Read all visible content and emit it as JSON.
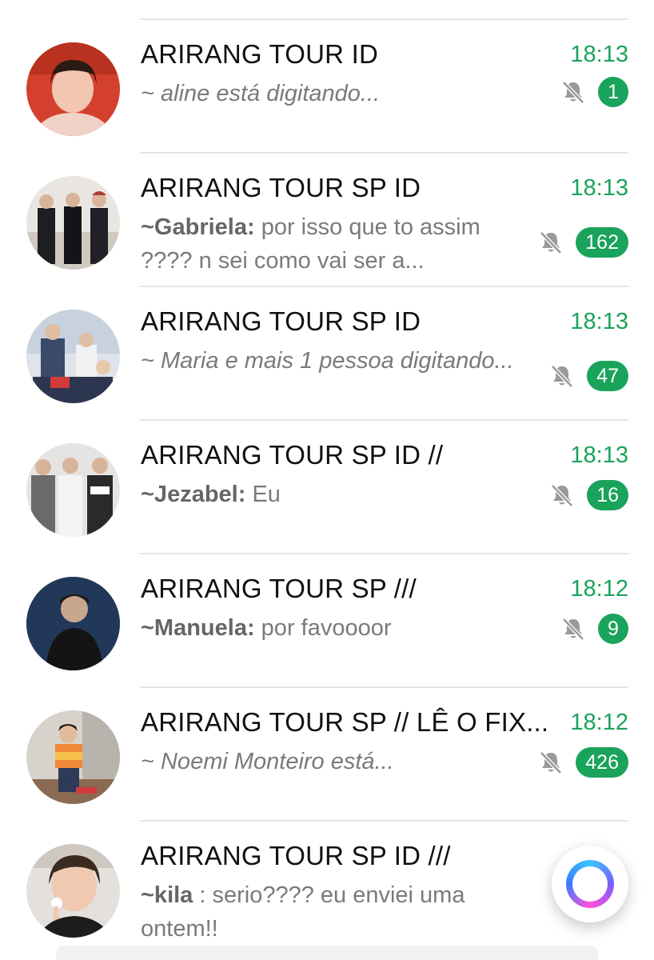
{
  "chats": [
    {
      "title": "ARIRANG TOUR ID",
      "time": "18:13",
      "sender": "",
      "message": "~ aline está digitando...",
      "italic": true,
      "muted": true,
      "unread": "1",
      "avatar_icon": "group-avatar-icon"
    },
    {
      "title": "ARIRANG TOUR SP ID",
      "time": "18:13",
      "sender": "~Gabriela:",
      "message": " por isso que to assim ???? n sei como vai ser a...",
      "italic": false,
      "muted": true,
      "unread": "162",
      "avatar_icon": "group-avatar-icon"
    },
    {
      "title": "ARIRANG TOUR SP ID",
      "time": "18:13",
      "sender": "",
      "message": "~ Maria e mais 1 pessoa digitando...",
      "italic": true,
      "muted": true,
      "unread": "47",
      "avatar_icon": "group-avatar-icon"
    },
    {
      "title": "ARIRANG TOUR SP ID //",
      "time": "18:13",
      "sender": "~Jezabel:",
      "message": " Eu",
      "italic": false,
      "muted": true,
      "unread": "16",
      "avatar_icon": "group-avatar-icon"
    },
    {
      "title": "ARIRANG TOUR SP ///",
      "time": "18:12",
      "sender": "~Manuela:",
      "message": " por favoooor",
      "italic": false,
      "muted": true,
      "unread": "9",
      "avatar_icon": "group-avatar-icon"
    },
    {
      "title": "ARIRANG TOUR SP // LÊ O FIX...",
      "time": "18:12",
      "sender": "",
      "message": "~ Noemi Monteiro está...",
      "italic": true,
      "muted": true,
      "unread": "426",
      "avatar_icon": "group-avatar-icon"
    },
    {
      "title": "ARIRANG TOUR SP ID ///",
      "time": "",
      "sender": "~kila",
      "message": " : serio???? eu enviei uma ontem!!",
      "italic": false,
      "muted": false,
      "unread": "",
      "avatar_icon": "group-avatar-icon"
    }
  ],
  "colors": {
    "accent": "#1aa35a",
    "title": "#111111",
    "preview": "#7a7a7a",
    "divider": "#e6e6e6"
  },
  "floating_button_icon": "assistant-ring-icon",
  "mute_icon": "bell-slash-icon"
}
